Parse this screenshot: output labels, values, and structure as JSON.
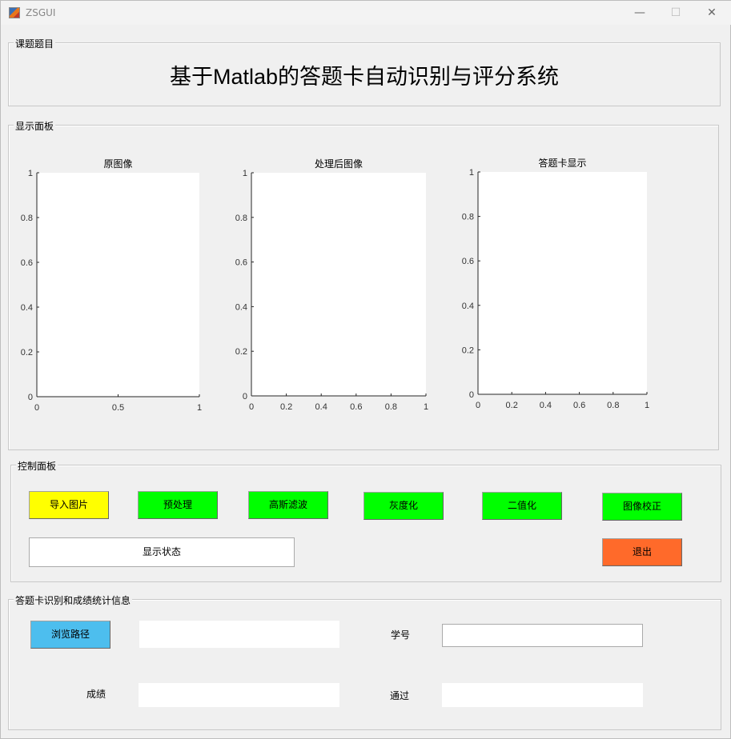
{
  "window": {
    "title": "ZSGUI",
    "minimize": "—",
    "maximize": "☐",
    "close": "✕"
  },
  "title_panel": {
    "legend": "课题题目",
    "heading": "基于Matlab的答题卡自动识别与评分系统"
  },
  "display_panel": {
    "legend": "显示面板"
  },
  "chart_data": [
    {
      "type": "line",
      "title": "原图像",
      "xlim": [
        0,
        1
      ],
      "ylim": [
        0,
        1
      ],
      "xticks": [
        "0",
        "0.5",
        "1"
      ],
      "yticks": [
        "0",
        "0.2",
        "0.4",
        "0.6",
        "0.8",
        "1"
      ],
      "series": []
    },
    {
      "type": "line",
      "title": "处理后图像",
      "xlim": [
        0,
        1
      ],
      "ylim": [
        0,
        1
      ],
      "xticks": [
        "0",
        "0.2",
        "0.4",
        "0.6",
        "0.8",
        "1"
      ],
      "yticks": [
        "0",
        "0.2",
        "0.4",
        "0.6",
        "0.8",
        "1"
      ],
      "series": []
    },
    {
      "type": "line",
      "title": "答题卡显示",
      "xlim": [
        0,
        1
      ],
      "ylim": [
        0,
        1
      ],
      "xticks": [
        "0",
        "0.2",
        "0.4",
        "0.6",
        "0.8",
        "1"
      ],
      "yticks": [
        "0",
        "0.2",
        "0.4",
        "0.6",
        "0.8",
        "1"
      ],
      "series": []
    }
  ],
  "control_panel": {
    "legend": "控制面板",
    "import": "导入图片",
    "preprocess": "预处理",
    "gaussian": "高斯滤波",
    "grayscale": "灰度化",
    "binarize": "二值化",
    "correct": "图像校正",
    "status": "显示状态",
    "exit": "退出"
  },
  "info_panel": {
    "legend": "答题卡识别和成绩统计信息",
    "browse": "浏览路径",
    "path_value": "",
    "student_id_label": "学号",
    "student_id_value": "",
    "score_label": "成绩",
    "score_value": "",
    "pass_label": "通过",
    "pass_value": ""
  },
  "colors": {
    "yellow": "#ffff00",
    "green": "#00ff00",
    "blue": "#4dbeee",
    "orange": "#ff6a2a"
  }
}
